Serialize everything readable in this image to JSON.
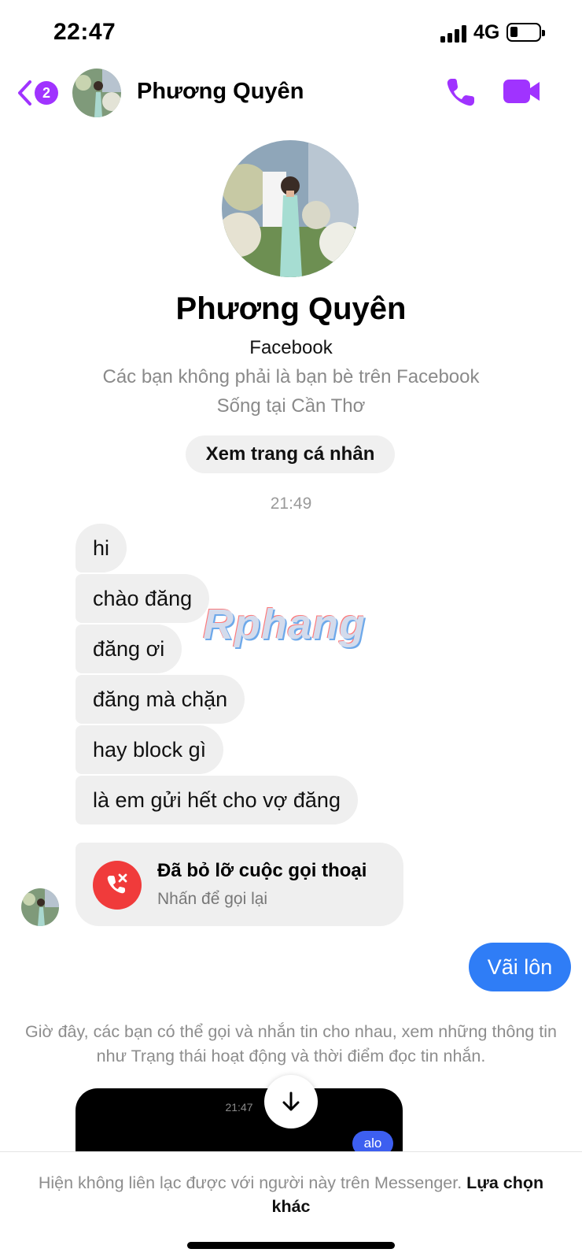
{
  "status_bar": {
    "time": "22:47",
    "network": "4G"
  },
  "header": {
    "back_badge": "2",
    "contact_name": "Phương Quyên"
  },
  "profile": {
    "name": "Phương Quyên",
    "platform": "Facebook",
    "friend_status": "Các bạn không phải là bạn bè trên Facebook",
    "location": "Sống tại Cần Thơ",
    "view_profile_label": "Xem trang cá nhân"
  },
  "conversation": {
    "timestamp": "21:49",
    "received_messages": [
      "hi",
      "chào đăng",
      "đăng ơi",
      "đăng mà chặn",
      "hay block gì",
      "là em gửi hết cho vợ đăng"
    ],
    "missed_call": {
      "title": "Đã bỏ lỡ cuộc gọi thoại",
      "subtitle": "Nhấn để gọi lại"
    },
    "sent_message": "Vãi lôn",
    "info_text": "Giờ đây, các bạn có thể gọi và nhắn tin cho nhau, xem những thông tin như Trạng thái hoạt động và thời điểm đọc tin nhắn.",
    "embedded_preview": {
      "time": "21:47",
      "bubble": "alo"
    }
  },
  "footer": {
    "text": "Hiện không liên lạc được với người này trên Messenger.",
    "link": "Lựa chọn khác"
  },
  "watermark": "Rphang",
  "colors": {
    "accent_purple": "#a033ff",
    "sent_bubble": "#2f7df6",
    "received_bubble": "#efefef",
    "missed_call_red": "#f03b3b"
  },
  "icons": {
    "back": "chevron-left-icon",
    "call": "phone-icon",
    "video": "video-camera-icon",
    "missed_call": "missed-call-icon",
    "scroll_down": "arrow-down-icon"
  }
}
